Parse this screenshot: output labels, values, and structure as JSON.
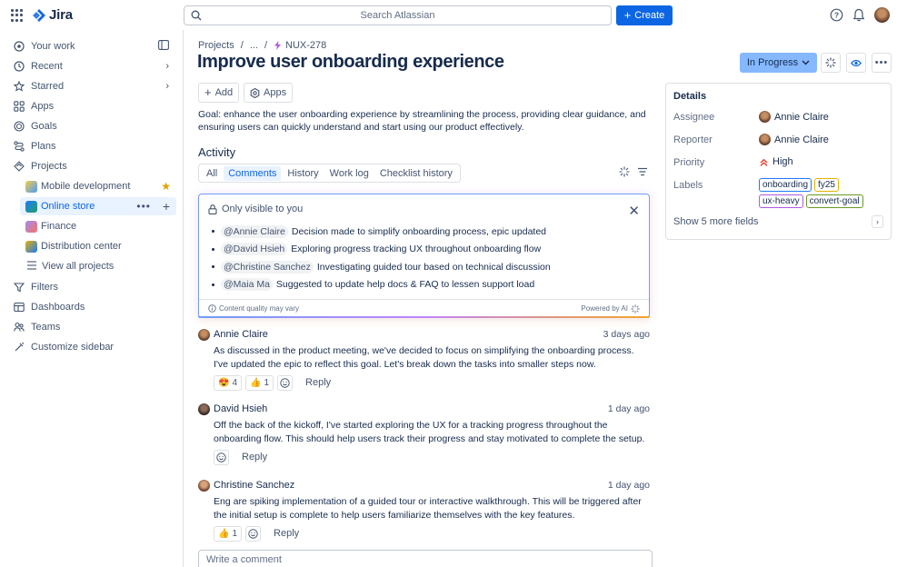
{
  "topbar": {
    "logo": "Jira",
    "search_placeholder": "Search Atlassian",
    "create_label": "Create"
  },
  "sidebar": {
    "items": [
      {
        "label": "Your work",
        "icon": "your-work-icon"
      },
      {
        "label": "Recent",
        "icon": "clock-icon"
      },
      {
        "label": "Starred",
        "icon": "star-icon"
      },
      {
        "label": "Apps",
        "icon": "apps-icon"
      },
      {
        "label": "Goals",
        "icon": "goals-icon"
      },
      {
        "label": "Plans",
        "icon": "plans-icon"
      },
      {
        "label": "Projects",
        "icon": "projects-icon"
      }
    ],
    "projects": [
      {
        "label": "Mobile development",
        "color": "#F5CD47"
      },
      {
        "label": "Online store",
        "color": "#1D7AFC"
      },
      {
        "label": "Finance",
        "color": "#9F8FEF"
      },
      {
        "label": "Distribution center",
        "color": "#E2B203"
      }
    ],
    "view_all": "View all projects",
    "bottom": [
      {
        "label": "Filters",
        "icon": "filter-icon"
      },
      {
        "label": "Dashboards",
        "icon": "dashboard-icon"
      },
      {
        "label": "Teams",
        "icon": "teams-icon"
      },
      {
        "label": "Customize sidebar",
        "icon": "customize-icon"
      }
    ]
  },
  "issue": {
    "breadcrumb": {
      "projects": "Projects",
      "sep": "/",
      "ellipsis": "...",
      "key": "NUX-278"
    },
    "title": "Improve user onboarding experience",
    "status": "In Progress",
    "add_label": "Add",
    "apps_label": "Apps",
    "goal": "Goal: enhance the user onboarding experience by streamlining the process, providing clear guidance, and ensuring users can quickly understand and start using our product effectively."
  },
  "activity": {
    "heading": "Activity",
    "tabs": [
      "All",
      "Comments",
      "History",
      "Work log",
      "Checklist history"
    ],
    "selected_tab": "Comments"
  },
  "ai_summary": {
    "header": "Only visible to you",
    "items": [
      {
        "mention": "@Annie Claire",
        "text": "Decision made to simplify onboarding process, epic updated"
      },
      {
        "mention": "@David Hsieh",
        "text": "Exploring progress tracking UX throughout onboarding flow"
      },
      {
        "mention": "@Christine Sanchez",
        "text": "Investigating guided tour based on technical discussion"
      },
      {
        "mention": "@Maia Ma",
        "text": "Suggested to update help docs & FAQ to lessen support load"
      }
    ],
    "footer_left": "Content quality may vary",
    "footer_right": "Powered by AI"
  },
  "comments": [
    {
      "author": "Annie Claire",
      "time": "3 days ago",
      "body": "As discussed in the product meeting, we've decided to focus on simplifying the onboarding process. I've updated the epic to reflect this goal. Let's break down the tasks into smaller steps now.",
      "reactions": [
        {
          "emoji": "😍",
          "count": "4"
        },
        {
          "emoji": "👍",
          "count": "1"
        }
      ],
      "reply": "Reply"
    },
    {
      "author": "David Hsieh",
      "time": "1 day ago",
      "body": "Off the back of the kickoff, I've started exploring the UX for a tracking progress throughout the onboarding flow. This should help users track their progress and stay motivated to complete the setup.",
      "reactions": [],
      "reply": "Reply"
    },
    {
      "author": "Christine Sanchez",
      "time": "1 day ago",
      "body": "Eng are spiking implementation of a guided tour or interactive walkthrough. This will be triggered after the initial setup is complete to help users familiarize themselves with the key features.",
      "reactions": [
        {
          "emoji": "👍",
          "count": "1"
        }
      ],
      "reply": "Reply"
    }
  ],
  "comment_placeholder": "Write a comment",
  "details": {
    "heading": "Details",
    "assignee_label": "Assignee",
    "assignee": "Annie Claire",
    "reporter_label": "Reporter",
    "reporter": "Annie Claire",
    "priority_label": "Priority",
    "priority": "High",
    "labels_label": "Labels",
    "labels": [
      {
        "text": "onboarding",
        "color": "#1D7AFC"
      },
      {
        "text": "fy25",
        "color": "#E2B203"
      },
      {
        "text": "ux-heavy",
        "color": "#AF59E1"
      },
      {
        "text": "convert-goal",
        "color": "#6A9A23"
      }
    ],
    "show_more": "Show 5 more fields"
  }
}
